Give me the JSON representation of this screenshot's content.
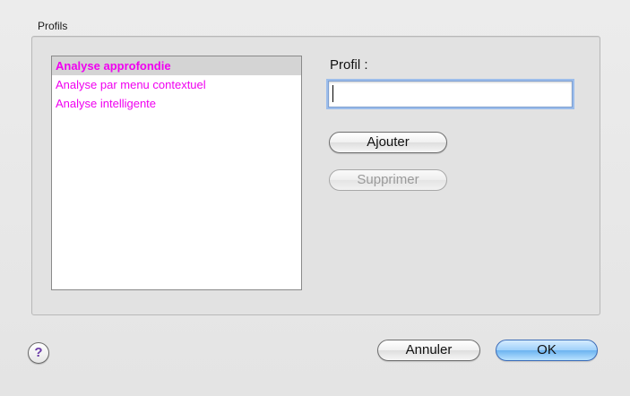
{
  "group": {
    "label": "Profils"
  },
  "list": {
    "items": [
      {
        "label": "Analyse approfondie",
        "selected": true
      },
      {
        "label": "Analyse par menu contextuel",
        "selected": false
      },
      {
        "label": "Analyse intelligente",
        "selected": false
      }
    ]
  },
  "profile": {
    "label": "Profil :",
    "value": "",
    "placeholder": ""
  },
  "buttons": {
    "add": "Ajouter",
    "remove": "Supprimer",
    "cancel": "Annuler",
    "ok": "OK",
    "help": "?"
  },
  "colors": {
    "list_text": "#f000f0",
    "default_button": "#6cb3f0"
  }
}
